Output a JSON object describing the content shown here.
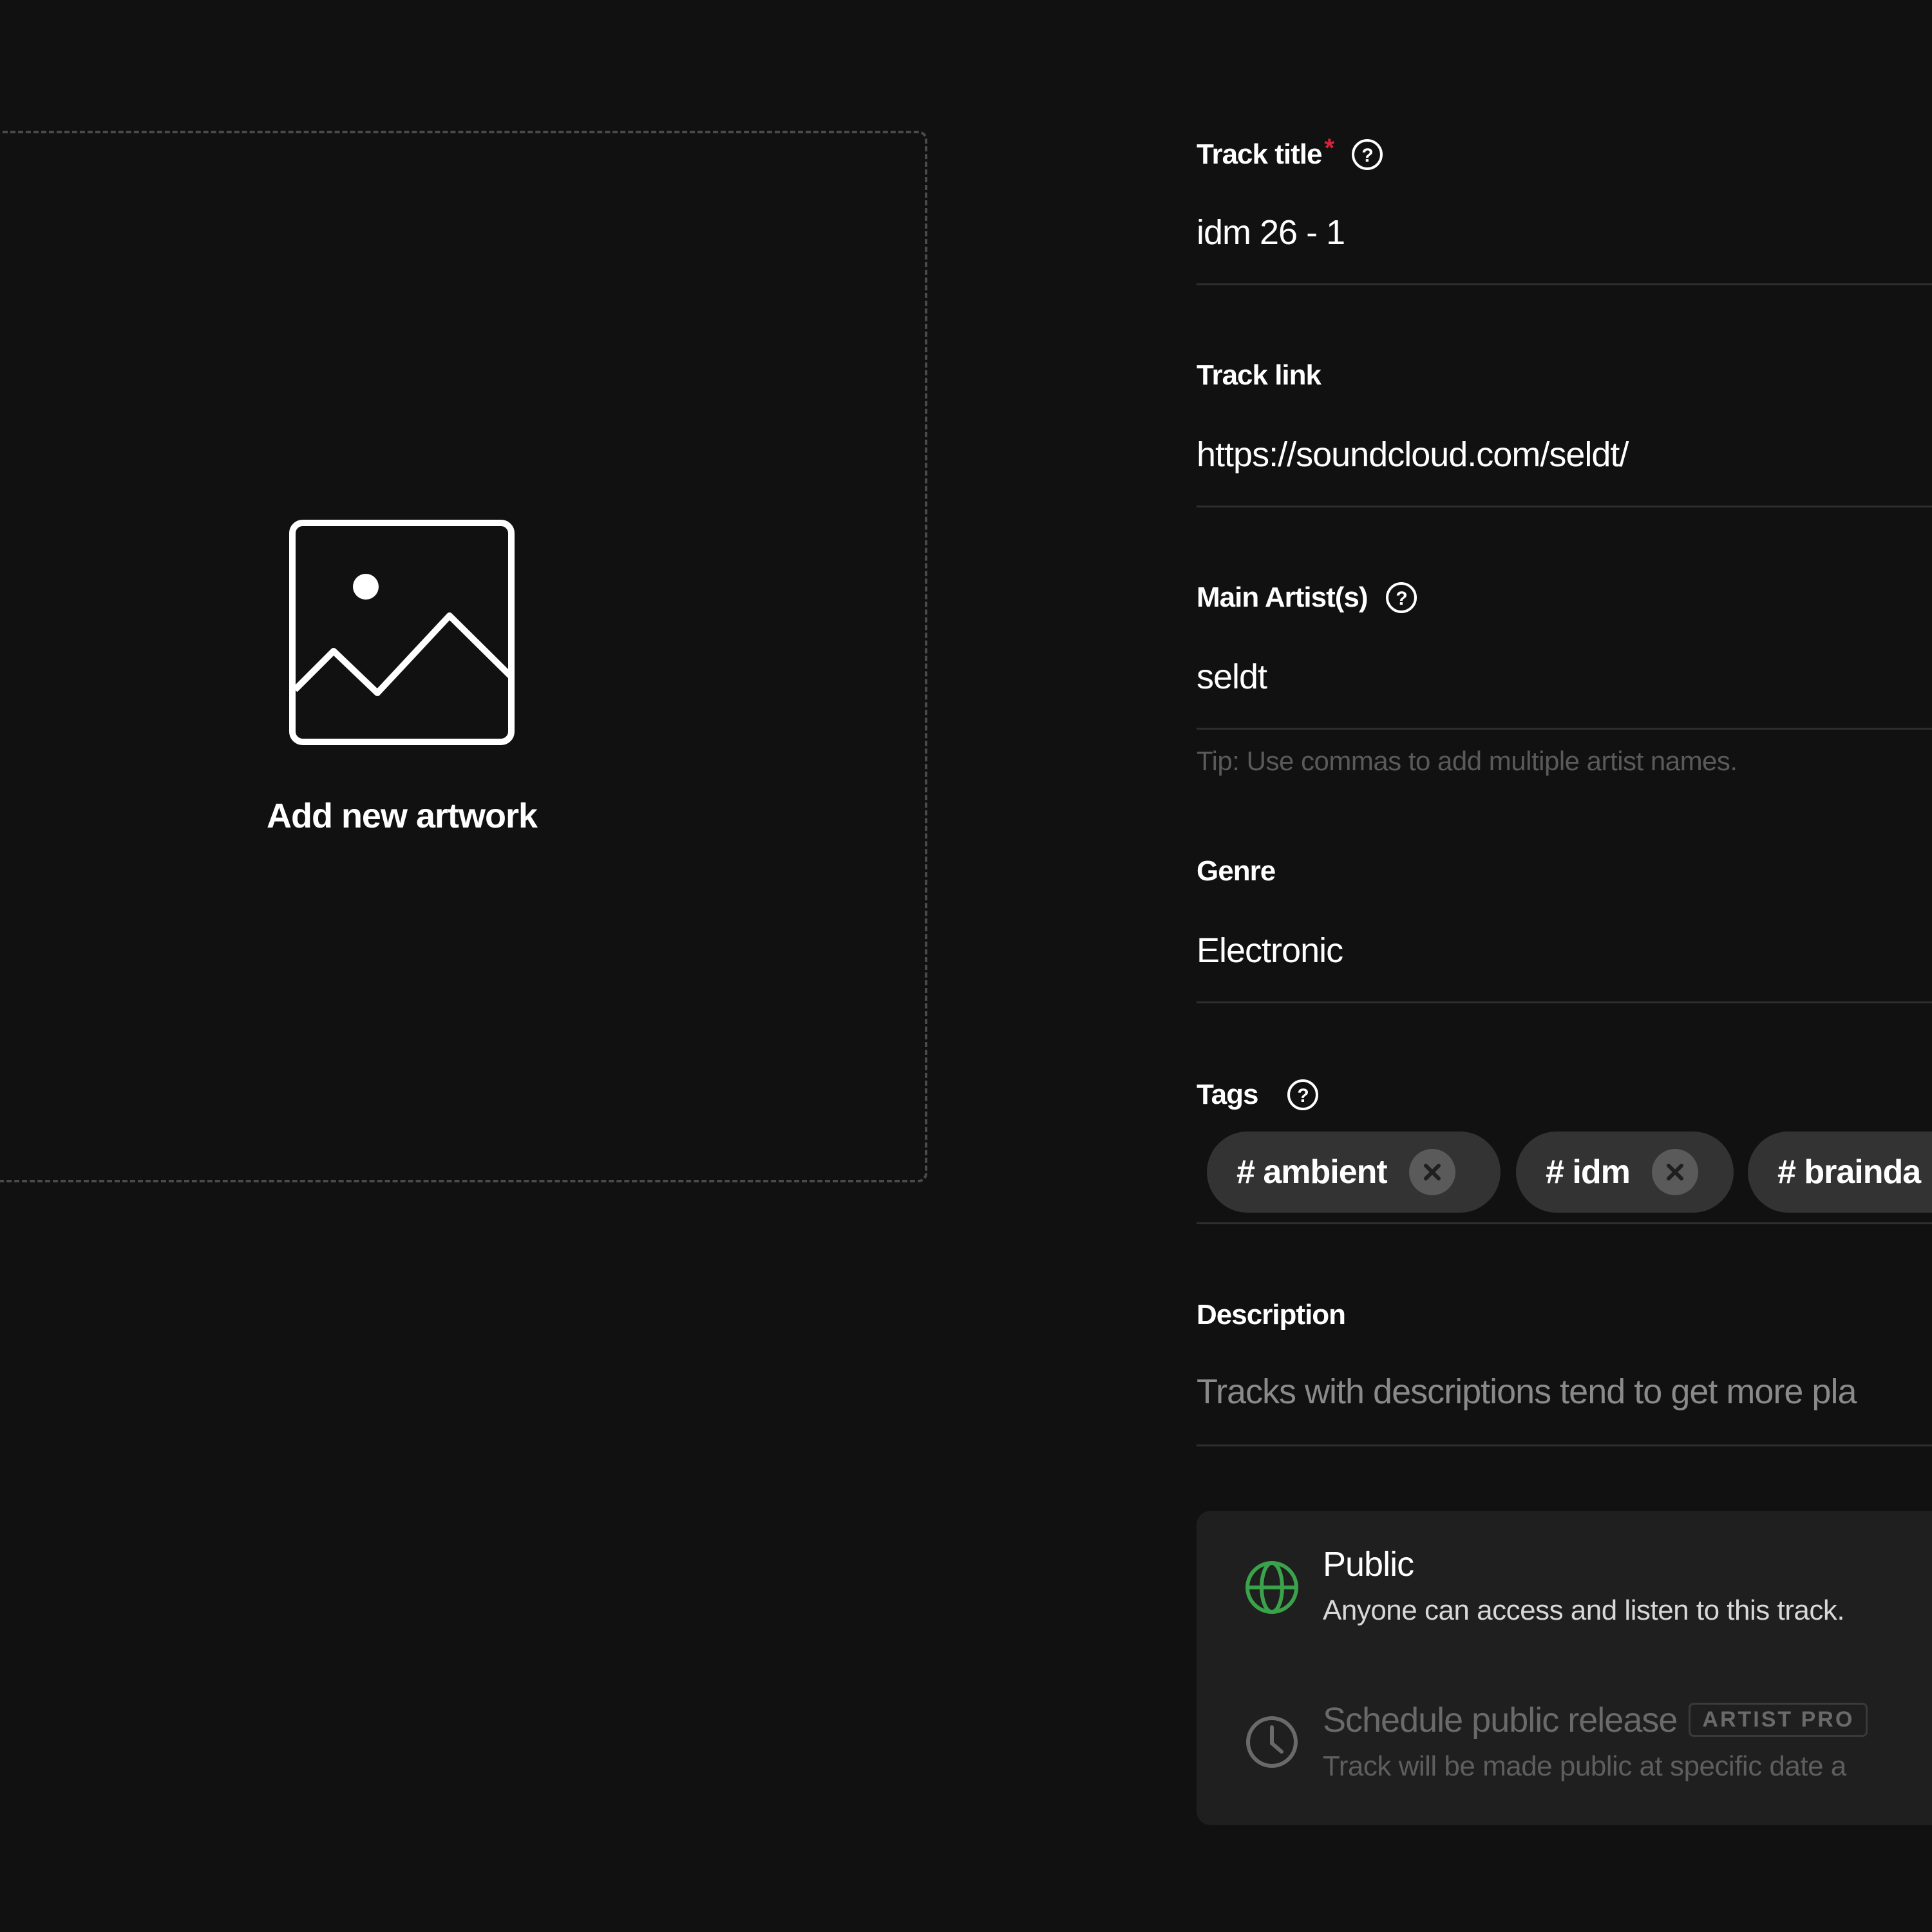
{
  "artwork": {
    "label": "Add new artwork"
  },
  "form": {
    "title": {
      "label": "Track title",
      "required_mark": "*",
      "value": "idm 26 - 1"
    },
    "link": {
      "label": "Track link",
      "value": "https://soundcloud.com/seldt/"
    },
    "artists": {
      "label": "Main Artist(s)",
      "value": "seldt",
      "tip": "Tip: Use commas to add multiple artist names."
    },
    "genre": {
      "label": "Genre",
      "value": "Electronic"
    },
    "tags": {
      "label": "Tags",
      "items": [
        "# ambient",
        "# idm",
        "# brainda"
      ]
    },
    "description": {
      "label": "Description",
      "placeholder": "Tracks with descriptions tend to get more pla"
    }
  },
  "privacy": {
    "public": {
      "title": "Public",
      "desc": "Anyone can access and listen to this track."
    },
    "schedule": {
      "title": "Schedule public release",
      "badge": "ARTIST PRO",
      "desc": "Track will be made public at specific date a"
    }
  },
  "colors": {
    "background": "#111112",
    "required": "#e0203a",
    "public_icon": "#3aa24a",
    "muted": "#6a6a6a"
  }
}
